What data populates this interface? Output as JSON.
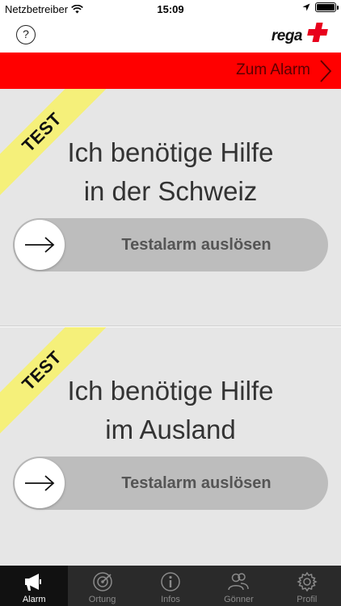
{
  "status_bar": {
    "carrier": "Netzbetreiber",
    "time": "15:09"
  },
  "header": {
    "help_label": "?",
    "logo_text": "rega"
  },
  "alarm_strip": {
    "link_label": "Zum Alarm"
  },
  "panels": [
    {
      "badge": "TEST",
      "title_line1": "Ich benötige Hilfe",
      "title_line2": "in der Schweiz",
      "slider_label": "Testalarm auslösen"
    },
    {
      "badge": "TEST",
      "title_line1": "Ich benötige Hilfe",
      "title_line2": "im Ausland",
      "slider_label": "Testalarm auslösen"
    }
  ],
  "tabs": [
    {
      "label": "Alarm",
      "icon": "megaphone-icon",
      "active": true
    },
    {
      "label": "Ortung",
      "icon": "location-radar-icon",
      "active": false
    },
    {
      "label": "Infos",
      "icon": "info-icon",
      "active": false
    },
    {
      "label": "Gönner",
      "icon": "people-icon",
      "active": false
    },
    {
      "label": "Profil",
      "icon": "gear-icon",
      "active": false
    }
  ],
  "colors": {
    "alarm_red": "#ff0000",
    "test_yellow": "#f5f07a",
    "panel_grey": "#e6e6e6",
    "slider_grey": "#bdbdbd",
    "tab_bar": "#2a2a2a"
  }
}
